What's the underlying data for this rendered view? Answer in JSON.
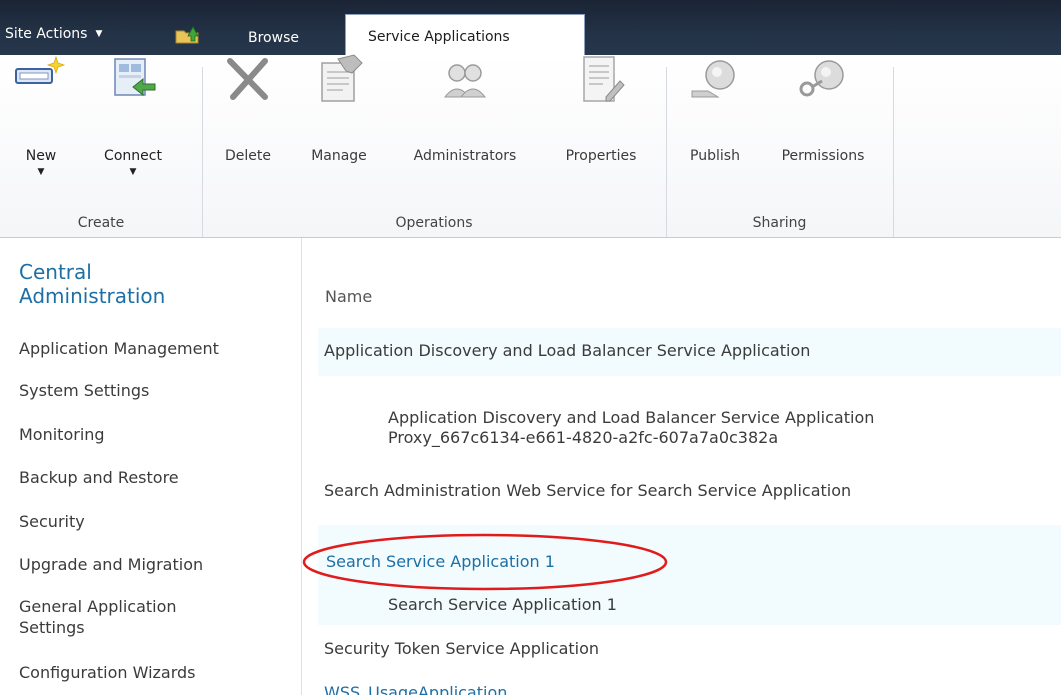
{
  "topbar": {
    "site_actions_label": "Site Actions",
    "tabs": [
      {
        "label": "Browse"
      },
      {
        "label": "Service Applications"
      }
    ]
  },
  "ribbon": {
    "groups": [
      {
        "label": "Create"
      },
      {
        "label": "Operations"
      },
      {
        "label": "Sharing"
      }
    ],
    "buttons": {
      "new": "New",
      "connect": "Connect",
      "delete": "Delete",
      "manage": "Manage",
      "administrators": "Administrators",
      "properties": "Properties",
      "publish": "Publish",
      "permissions": "Permissions"
    }
  },
  "leftnav": {
    "title_line1": "Central",
    "title_line2": "Administration",
    "items": [
      {
        "label": "Application Management"
      },
      {
        "label": "System Settings"
      },
      {
        "label": "Monitoring"
      },
      {
        "label": "Backup and Restore"
      },
      {
        "label": "Security"
      },
      {
        "label": "Upgrade and Migration"
      },
      {
        "label": "General Application"
      },
      {
        "label": "Settings"
      },
      {
        "label": "Configuration Wizards"
      }
    ]
  },
  "list": {
    "column_header": "Name",
    "rows": [
      {
        "line1": "Application Discovery and Load Balancer Service Application"
      },
      {
        "line1": "Application Discovery and Load Balancer Service Application",
        "line2": "Proxy_667c6134-e661-4820-a2fc-607a7a0c382a"
      },
      {
        "line1": "Search Administration Web Service for Search Service Application"
      },
      {
        "line1": "Search Service Application 1"
      },
      {
        "line1": "Search Service Application 1"
      },
      {
        "line1": "Security Token Service Application"
      },
      {
        "line1": "WSS_UsageApplication"
      }
    ]
  },
  "colors": {
    "link": "#1d6fa5",
    "highlight_ellipse": "#e01b1b",
    "row_alt": "#f2fbfd",
    "topbar": "#1a2435"
  }
}
